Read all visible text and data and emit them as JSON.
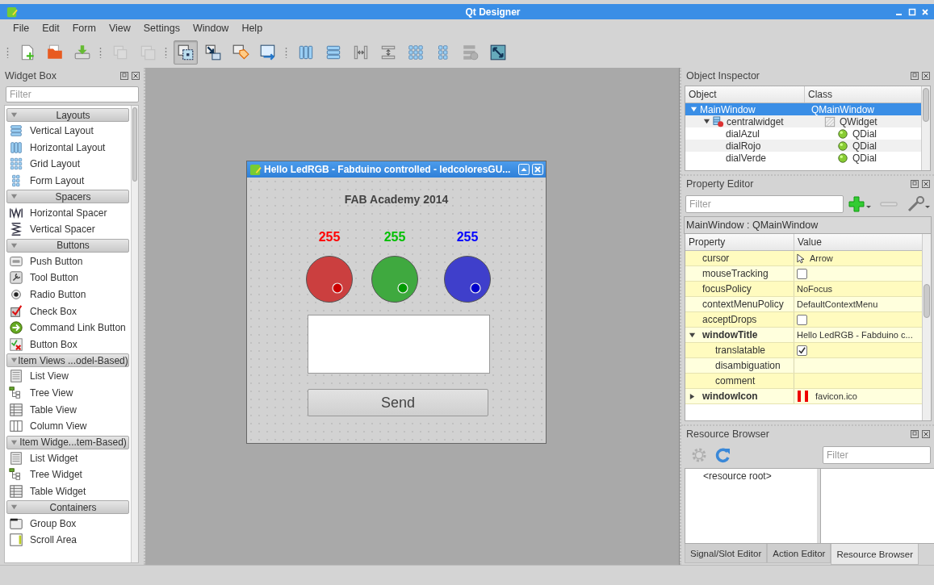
{
  "window": {
    "title": "Qt Designer"
  },
  "menu": [
    "File",
    "Edit",
    "Form",
    "View",
    "Settings",
    "Window",
    "Help"
  ],
  "toolbar": {
    "groups": [
      {
        "buttons": [
          {
            "kind": "new",
            "selected": false,
            "disabled": false
          },
          {
            "kind": "open",
            "selected": false,
            "disabled": false
          },
          {
            "kind": "save",
            "selected": false,
            "disabled": false
          }
        ]
      },
      {
        "buttons": [
          {
            "kind": "copy",
            "selected": false,
            "disabled": true
          },
          {
            "kind": "paste",
            "selected": false,
            "disabled": true
          }
        ]
      },
      {
        "buttons": [
          {
            "kind": "edit-widgets",
            "selected": true,
            "disabled": false
          },
          {
            "kind": "edit-signals",
            "selected": false,
            "disabled": false
          },
          {
            "kind": "edit-buddies",
            "selected": false,
            "disabled": false
          },
          {
            "kind": "edit-tab-order",
            "selected": false,
            "disabled": false
          }
        ]
      },
      {
        "buttons": [
          {
            "kind": "hlayout",
            "selected": false,
            "disabled": false
          },
          {
            "kind": "vlayout",
            "selected": false,
            "disabled": false
          },
          {
            "kind": "hsplit",
            "selected": false,
            "disabled": false
          },
          {
            "kind": "vsplit",
            "selected": false,
            "disabled": false
          },
          {
            "kind": "grid",
            "selected": false,
            "disabled": false
          },
          {
            "kind": "form",
            "selected": false,
            "disabled": false
          },
          {
            "kind": "break",
            "selected": false,
            "disabled": true
          },
          {
            "kind": "adjust",
            "selected": false,
            "disabled": false
          }
        ]
      }
    ]
  },
  "widget_box": {
    "title": "Widget Box",
    "filter": {
      "placeholder": "Filter"
    },
    "sections": [
      {
        "title": "Layouts",
        "expanded": true,
        "items": [
          {
            "label": "Vertical Layout",
            "kind": "vlayout"
          },
          {
            "label": "Horizontal Layout",
            "kind": "hlayout"
          },
          {
            "label": "Grid Layout",
            "kind": "grid"
          },
          {
            "label": "Form Layout",
            "kind": "form"
          }
        ]
      },
      {
        "title": "Spacers",
        "expanded": true,
        "items": [
          {
            "label": "Horizontal Spacer",
            "kind": "hspacer"
          },
          {
            "label": "Vertical Spacer",
            "kind": "vspacer"
          }
        ]
      },
      {
        "title": "Buttons",
        "expanded": true,
        "items": [
          {
            "label": "Push Button",
            "kind": "pushbutton"
          },
          {
            "label": "Tool Button",
            "kind": "toolbutton"
          },
          {
            "label": "Radio Button",
            "kind": "radio"
          },
          {
            "label": "Check Box",
            "kind": "checkbox"
          },
          {
            "label": "Command Link Button",
            "kind": "commandlink"
          },
          {
            "label": "Button Box",
            "kind": "buttonbox"
          }
        ]
      },
      {
        "title": "Item Views ...odel-Based)",
        "expanded": true,
        "items": [
          {
            "label": "List View",
            "kind": "list"
          },
          {
            "label": "Tree View",
            "kind": "tree"
          },
          {
            "label": "Table View",
            "kind": "table"
          },
          {
            "label": "Column View",
            "kind": "columnview"
          }
        ]
      },
      {
        "title": "Item Widge...tem-Based)",
        "expanded": true,
        "items": [
          {
            "label": "List Widget",
            "kind": "list"
          },
          {
            "label": "Tree Widget",
            "kind": "tree"
          },
          {
            "label": "Table Widget",
            "kind": "table"
          }
        ]
      },
      {
        "title": "Containers",
        "expanded": true,
        "items": [
          {
            "label": "Group Box",
            "kind": "groupbox"
          },
          {
            "label": "Scroll Area",
            "kind": "scrollarea"
          }
        ]
      }
    ]
  },
  "form": {
    "title": "Hello LedRGB - Fabduino controlled - ledcoloresGU...",
    "heading": "FAB  Academy 2014",
    "dials": [
      {
        "reading": "255",
        "color": "#ff0000"
      },
      {
        "reading": "255",
        "color": "#00c000"
      },
      {
        "reading": "255",
        "color": "#0000ff"
      }
    ],
    "button": "Send"
  },
  "object_inspector": {
    "title": "Object Inspector",
    "columns": [
      "Object",
      "Class"
    ],
    "rows": [
      {
        "object": "MainWindow",
        "class": "QMainWindow",
        "selected": true,
        "expanded": true,
        "children": [
          {
            "object": "centralwidget",
            "class": "QWidget",
            "kind": "widget",
            "selected": false,
            "expanded": true,
            "children": [
              {
                "object": "dialAzul",
                "class": "QDial",
                "kind": "dial",
                "selected": false
              },
              {
                "object": "dialRojo",
                "class": "QDial",
                "kind": "dial",
                "selected": false
              },
              {
                "object": "dialVerde",
                "class": "QDial",
                "kind": "dial",
                "selected": false
              }
            ]
          }
        ]
      }
    ]
  },
  "property_editor": {
    "title": "Property Editor",
    "filter": {
      "placeholder": "Filter"
    },
    "object_label": "MainWindow : QMainWindow",
    "columns": [
      "Property",
      "Value"
    ],
    "rows": [
      {
        "name": "cursor",
        "kind": "cursor",
        "value": "Arrow",
        "changed": false
      },
      {
        "name": "mouseTracking",
        "kind": "checkbox",
        "checked": false,
        "changed": false
      },
      {
        "name": "focusPolicy",
        "kind": "text",
        "value": "NoFocus",
        "changed": false
      },
      {
        "name": "contextMenuPolicy",
        "kind": "text",
        "value": "DefaultContextMenu",
        "changed": false
      },
      {
        "name": "acceptDrops",
        "kind": "checkbox",
        "checked": false,
        "changed": false
      },
      {
        "name": "windowTitle",
        "kind": "text",
        "value": "Hello LedRGB - Fabduino c...",
        "changed": true,
        "expanded": true,
        "children": [
          {
            "name": "translatable",
            "kind": "checkbox",
            "checked": true,
            "changed": false
          },
          {
            "name": "disambiguation",
            "kind": "text",
            "changed": false
          },
          {
            "name": "comment",
            "kind": "text",
            "changed": false
          }
        ]
      },
      {
        "name": "windowIcon",
        "kind": "icon",
        "value": "favicon.ico",
        "changed": true,
        "expanded": false
      }
    ]
  },
  "resource_browser": {
    "title": "Resource Browser",
    "filter": {
      "placeholder": "Filter"
    },
    "tools": [
      {
        "kind": "settings",
        "disabled": true
      },
      {
        "kind": "reload",
        "disabled": false
      }
    ],
    "tree": [
      "<resource root>"
    ]
  },
  "bottom_tabs": [
    {
      "label": "Signal/Slot Editor",
      "selected": false
    },
    {
      "label": "Action Editor",
      "selected": false
    },
    {
      "label": "Resource Browser",
      "selected": true
    }
  ]
}
